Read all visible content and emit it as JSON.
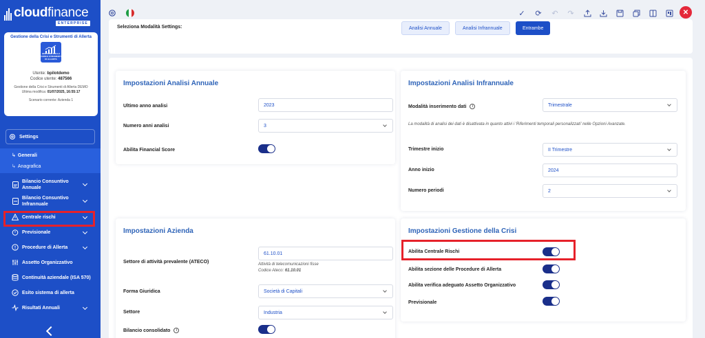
{
  "brand": {
    "name_bold": "cloud",
    "name_light": "finance",
    "sub": "ENTERPRISE"
  },
  "profile": {
    "title": "Gestione della Crisi e Strumenti di Allerta",
    "logo_text": "GESTIONE DELLA CRISI E STRUMENTI DI ALLERTA",
    "user_label": "Utente:",
    "user_value": "bpilotdemo",
    "code_label": "Codice utente:",
    "code_value": "487566",
    "product": "Gestione della Crisi e Strumenti di Allerta DEMO",
    "modified_label": "Ultima modifica:",
    "modified_value": "01/07/2025, 16:55:17",
    "scenario": "Scenario corrente: Azienda 1"
  },
  "sidebar": {
    "settings_label": "Settings",
    "sub_items": [
      "Generali",
      "Anagrafica"
    ],
    "items": [
      {
        "label": "Bilancio Consuntivo Annuale",
        "icon": "document-icon"
      },
      {
        "label": "Bilancio Consuntivo Infrannuale",
        "icon": "document-icon"
      },
      {
        "label": "Centrale rischi",
        "icon": "warning-icon"
      },
      {
        "label": "Previsionale",
        "icon": "stopwatch-icon"
      },
      {
        "label": "Procedure di Allerta",
        "icon": "alert-circle-icon"
      },
      {
        "label": "Assetto Organizzativo",
        "icon": "org-chart-icon"
      },
      {
        "label": "Continuità aziendale (ISA 570)",
        "icon": "database-icon"
      },
      {
        "label": "Esito sistema di allerta",
        "icon": "check-circle-icon"
      },
      {
        "label": "Risultati Annuali",
        "icon": "pulse-icon"
      }
    ]
  },
  "topbar": {
    "icons": [
      "settings-icon",
      "flag-it-icon",
      "check-icon",
      "refresh-icon",
      "undo-icon",
      "redo-icon",
      "upload-icon",
      "download-icon",
      "save-icon",
      "copy-icon",
      "columns-icon",
      "layout-icon",
      "close-icon"
    ],
    "close_label": "✕"
  },
  "mode": {
    "label": "Seleziona Modalità Settings:",
    "options": [
      "Analisi Annuale",
      "Analisi Infrannuale",
      "Entrambe"
    ],
    "selected": "Entrambe"
  },
  "annual": {
    "title": "Impostazioni Analisi Annuale",
    "last_year_label": "Ultimo anno analisi",
    "last_year_value": "2023",
    "years_label": "Numero anni analisi",
    "years_value": "3",
    "financial_score_label": "Abilita Financial Score",
    "financial_score_on": true
  },
  "interim": {
    "title": "Impostazioni Analisi Infrannuale",
    "mode_label": "Modalità inserimento dati",
    "mode_value": "Trimestrale",
    "note": "La modalità di analisi dei dati è disattivata in quanto attivi i 'Riferimenti temporali personalizzati' nelle Opzioni Avanzate.",
    "start_quarter_label": "Trimestre inizio",
    "start_quarter_value": "II Trimestre",
    "start_year_label": "Anno inizio",
    "start_year_value": "2024",
    "periods_label": "Numero periodi",
    "periods_value": "2"
  },
  "company": {
    "title": "Impostazioni Azienda",
    "sector_label": "Settore di attività prevalente (ATECO)",
    "ateco_value": "61.10.01",
    "ateco_desc": "Attività di telecomunicazioni fisse",
    "ateco_code_label": "Codice Ateco:",
    "ateco_code_value": "61.10.01",
    "legal_form_label": "Forma Giuridica",
    "legal_form_value": "Società di Capitali",
    "sector2_label": "Settore",
    "sector2_value": "Industria",
    "consolidated_label": "Bilancio consolidato"
  },
  "crisis": {
    "title": "Impostazioni Gestione della Crisi",
    "toggles": [
      {
        "label": "Abilita Centrale Rischi",
        "on": true
      },
      {
        "label": "Abilita sezione delle Procedure di Allerta",
        "on": true
      },
      {
        "label": "Abilita verifica adeguato Assetto Organizzativo",
        "on": true
      },
      {
        "label": "Previsionale",
        "on": true
      }
    ]
  },
  "colors": {
    "primary": "#1d4fc7",
    "accent_title": "#2f64b8",
    "toggle": "#1a2f8a",
    "highlight": "#e6212a",
    "close": "#e4283a"
  }
}
